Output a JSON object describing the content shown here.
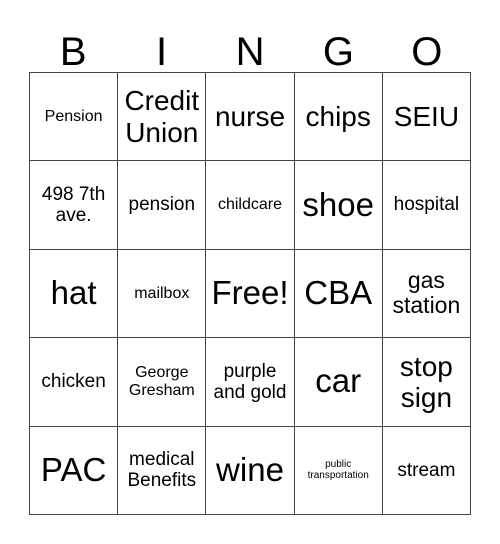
{
  "card": {
    "header_letters": [
      "B",
      "I",
      "N",
      "G",
      "O"
    ],
    "grid_size": "5x5",
    "free_space_label": "Free!",
    "border_color": "#444444",
    "text_color": "#000000",
    "background_color": "#ffffff",
    "rows": [
      [
        {
          "text": "Pension",
          "size": "s"
        },
        {
          "text": "Credit Union",
          "size": "xl"
        },
        {
          "text": "nurse",
          "size": "xl"
        },
        {
          "text": "chips",
          "size": "xl"
        },
        {
          "text": "SEIU",
          "size": "xl"
        }
      ],
      [
        {
          "text": "498 7th ave.",
          "size": "m"
        },
        {
          "text": "pension",
          "size": "m"
        },
        {
          "text": "childcare",
          "size": "s"
        },
        {
          "text": "shoe",
          "size": "xxl"
        },
        {
          "text": "hospital",
          "size": "m"
        }
      ],
      [
        {
          "text": "hat",
          "size": "xxl"
        },
        {
          "text": "mailbox",
          "size": "s"
        },
        {
          "text": "Free!",
          "size": "xxl"
        },
        {
          "text": "CBA",
          "size": "xxl"
        },
        {
          "text": "gas station",
          "size": "l"
        }
      ],
      [
        {
          "text": "chicken",
          "size": "m"
        },
        {
          "text": "George Gresham",
          "size": "s"
        },
        {
          "text": "purple and gold",
          "size": "m"
        },
        {
          "text": "car",
          "size": "xxl"
        },
        {
          "text": "stop sign",
          "size": "xl"
        }
      ],
      [
        {
          "text": "PAC",
          "size": "xxl"
        },
        {
          "text": "medical Benefits",
          "size": "m"
        },
        {
          "text": "wine",
          "size": "xxl"
        },
        {
          "text": "public transportation",
          "size": "xxs"
        },
        {
          "text": "stream",
          "size": "m"
        }
      ]
    ]
  }
}
